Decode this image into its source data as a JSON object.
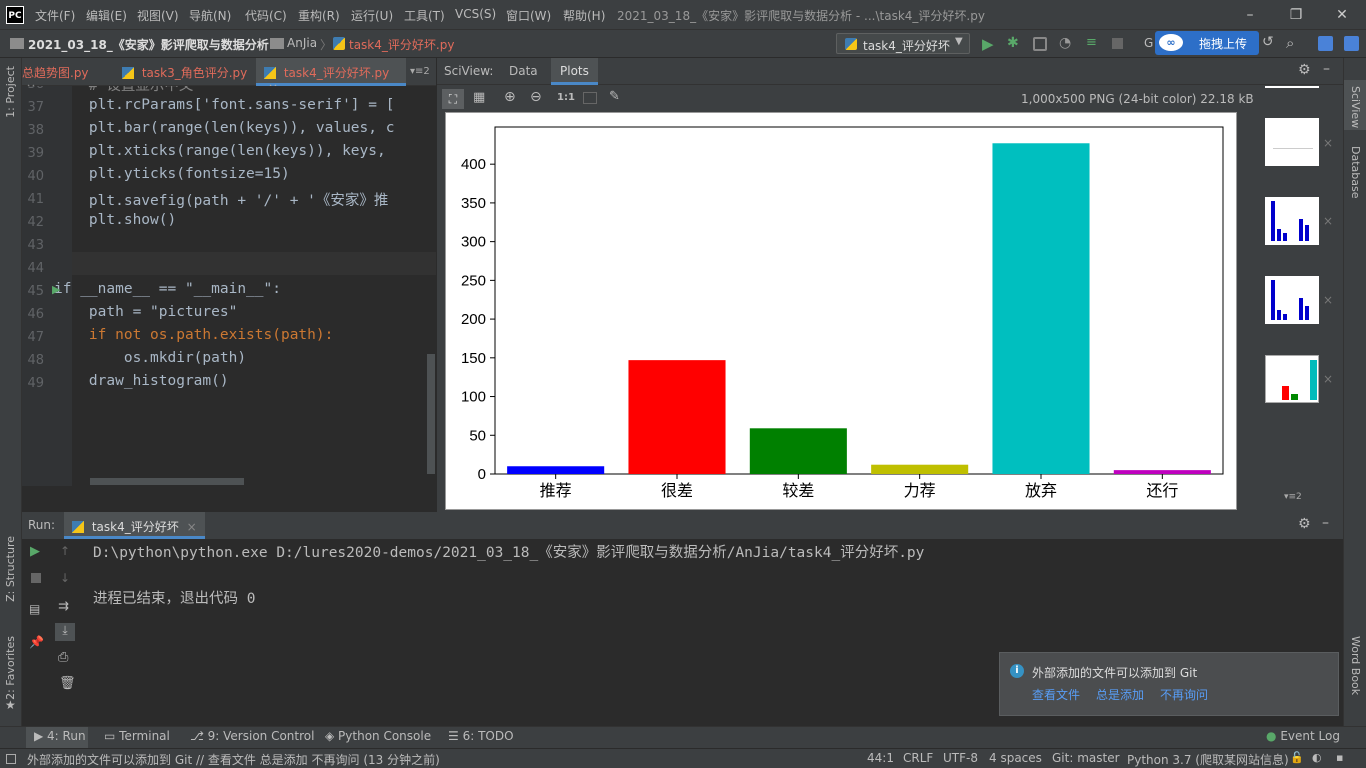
{
  "titlebar": {
    "logo": "PC",
    "menus": [
      "文件(F)",
      "编辑(E)",
      "视图(V)",
      "导航(N)",
      "代码(C)",
      "重构(R)",
      "运行(U)",
      "工具(T)",
      "VCS(S)",
      "窗口(W)",
      "帮助(H)"
    ],
    "title": "2021_03_18_《安家》影评爬取与数据分析 - ...\\task4_评分好坏.py"
  },
  "navbar": {
    "crumbs": [
      "2021_03_18_《安家》影评爬取与数据分析",
      "AnJia",
      "task4_评分好坏.py"
    ],
    "run_config": "task4_评分好坏",
    "upload_label": "拖拽上传",
    "git_label": "G"
  },
  "left_strip": {
    "project": "1: Project",
    "structure": "Z: Structure",
    "favorites": "2: Favorites"
  },
  "right_strip": {
    "sciview": "SciView",
    "database": "Database",
    "wordbook": "Word Book"
  },
  "editor_tabs": [
    {
      "label": "总趋势图.py"
    },
    {
      "label": "task3_角色评分.py"
    },
    {
      "label": "task4_评分好坏.py",
      "active": true
    }
  ],
  "editor_tab_overflow": "▾≡2",
  "code_lines": [
    {
      "n": "36",
      "text": "    # 设置显示中文"
    },
    {
      "n": "37",
      "text": "    plt.rcParams['font.sans-serif'] = ["
    },
    {
      "n": "38",
      "text": "    plt.bar(range(len(keys)), values, c"
    },
    {
      "n": "39",
      "text": "    plt.xticks(range(len(keys)), keys,"
    },
    {
      "n": "40",
      "text": "    plt.yticks(fontsize=15)"
    },
    {
      "n": "41",
      "text": "    plt.savefig(path + '/' + '《安家》推"
    },
    {
      "n": "42",
      "text": "    plt.show()"
    },
    {
      "n": "43",
      "text": ""
    },
    {
      "n": "44",
      "text": ""
    },
    {
      "n": "45",
      "text": "if __name__ == \"__main__\":"
    },
    {
      "n": "46",
      "text": "    path = \"pictures\""
    },
    {
      "n": "47",
      "text": "    if not os.path.exists(path):"
    },
    {
      "n": "48",
      "text": "        os.mkdir(path)"
    },
    {
      "n": "49",
      "text": "    draw_histogram()"
    }
  ],
  "sciview": {
    "header_label": "SciView:",
    "tabs": [
      "Data",
      "Plots"
    ],
    "active_tab": "Plots",
    "image_info": "1,000x500 PNG (24-bit color) 22.18 kB",
    "zoom_label": "1:1",
    "thumb_overflow": "▾≡2"
  },
  "chart_data": {
    "type": "bar",
    "categories": [
      "推荐",
      "很差",
      "较差",
      "力荐",
      "放弃",
      "还行"
    ],
    "values": [
      10,
      147,
      59,
      12,
      427,
      5
    ],
    "colors": [
      "#0000ff",
      "#ff0000",
      "#008000",
      "#bfbf00",
      "#00bfbf",
      "#bf00bf"
    ],
    "yticks": [
      0,
      50,
      100,
      150,
      200,
      250,
      300,
      350,
      400
    ],
    "ylim": [
      0,
      448
    ],
    "title": "",
    "xlabel": "",
    "ylabel": ""
  },
  "run_panel": {
    "label": "Run:",
    "tab": "task4_评分好坏",
    "command": "D:\\python\\python.exe D:/lures2020-demos/2021_03_18_《安家》影评爬取与数据分析/AnJia/task4_评分好坏.py",
    "exit_message": "进程已结束，退出代码 0"
  },
  "notification": {
    "message": "外部添加的文件可以添加到 Git",
    "actions": [
      "查看文件",
      "总是添加",
      "不再询问"
    ]
  },
  "tool_windows": [
    "4: Run",
    "Terminal",
    "9: Version Control",
    "Python Console",
    "6: TODO"
  ],
  "event_log": "Event Log",
  "status": {
    "message": "外部添加的文件可以添加到 Git // 查看文件   总是添加   不再询问 (13 分钟之前)",
    "position": "44:1",
    "line_sep": "CRLF",
    "encoding": "UTF-8",
    "indent": "4 spaces",
    "git": "Git: master",
    "interpreter": "Python 3.7 (爬取某网站信息)"
  }
}
